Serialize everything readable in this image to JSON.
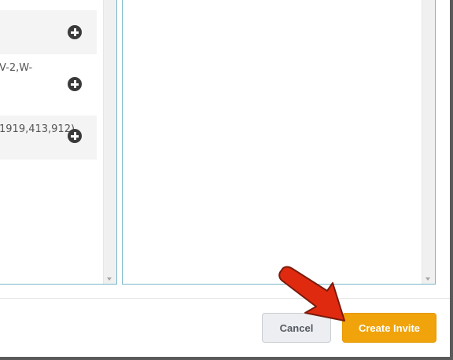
{
  "left_list": {
    "items": [
      {
        "text": ""
      },
      {
        "text": "V-2,W-"
      },
      {
        "text": "1919,413,912)"
      }
    ]
  },
  "footer": {
    "cancel_label": "Cancel",
    "create_label": "Create Invite"
  },
  "colors": {
    "accent": "#f0a30a",
    "annotation_arrow": "#e02a10"
  },
  "icons": [
    "plus-circle-icon",
    "scroll-down-arrow-icon"
  ]
}
